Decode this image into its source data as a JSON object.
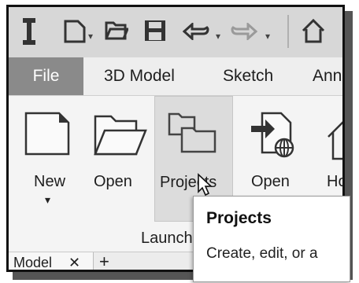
{
  "tabs": {
    "file": "File",
    "model": "3D Model",
    "sketch": "Sketch",
    "annotate_partial": "Ann"
  },
  "ribbon": {
    "buttons": [
      {
        "label": "New",
        "icon": "new-document-icon"
      },
      {
        "label": "Open",
        "icon": "open-folder-icon"
      },
      {
        "label": "Projects",
        "icon": "projects-folder-icon"
      },
      {
        "label": "Open",
        "icon": "open-samples-icon"
      },
      {
        "label": "Ho",
        "icon": "home-icon"
      }
    ],
    "group_label": "Launch"
  },
  "tooltip": {
    "title": "Projects",
    "description": "Create, edit, or a"
  },
  "document_tabs": {
    "model_tab": "Model",
    "close_glyph": "✕",
    "add_glyph": "+"
  }
}
